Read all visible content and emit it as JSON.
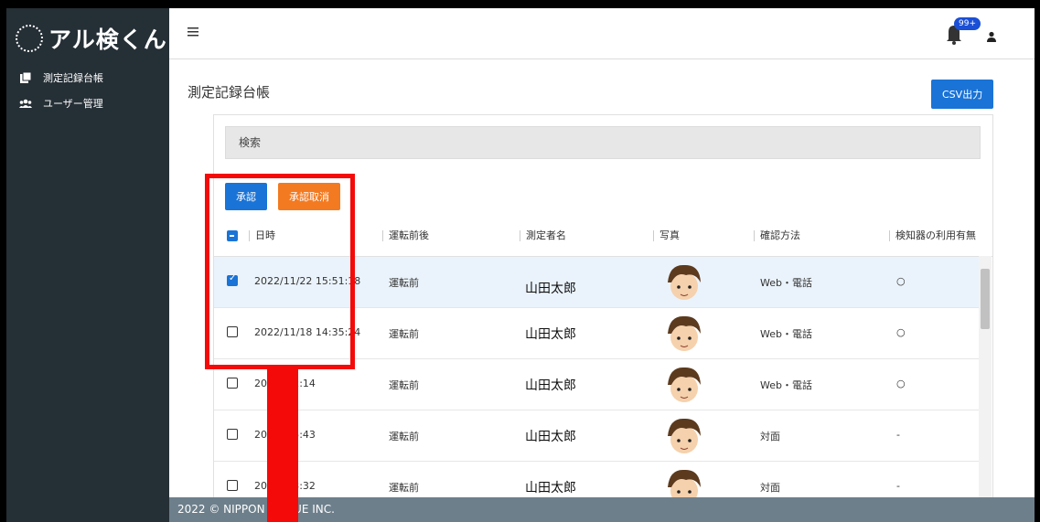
{
  "app": {
    "logo_text": "アル検くん"
  },
  "sidebar": {
    "items": [
      {
        "label": "測定記録台帳",
        "icon": "ledger-icon"
      },
      {
        "label": "ユーザー管理",
        "icon": "users-icon"
      }
    ]
  },
  "header": {
    "notification_badge": "99+",
    "icons": [
      "menu-icon",
      "bell-icon",
      "user-icon"
    ]
  },
  "page": {
    "title": "測定記録台帳",
    "csv_button": "CSV出力"
  },
  "search": {
    "label": "検索"
  },
  "actions": {
    "approve": "承認",
    "cancel_approve": "承認取消"
  },
  "table": {
    "headers": [
      "日時",
      "運転前後",
      "測定者名",
      "写真",
      "確認方法",
      "検知器の利用有無"
    ],
    "header_checkbox": "indeterminate",
    "rows": [
      {
        "checked": true,
        "datetime": "2022/11/22 15:51:18",
        "timing": "運転前",
        "name": "山田太郎",
        "method": "Web・電話",
        "detector": "○"
      },
      {
        "checked": false,
        "datetime": "2022/11/18 14:35:24",
        "timing": "運転前",
        "name": "山田太郎",
        "method": "Web・電話",
        "detector": "○"
      },
      {
        "checked": false,
        "datetime": "2022 :52:14",
        "timing": "運転前",
        "name": "山田太郎",
        "method": "Web・電話",
        "detector": "○"
      },
      {
        "checked": false,
        "datetime": "2022 :45:43",
        "timing": "運転前",
        "name": "山田太郎",
        "method": "対面",
        "detector": "-"
      },
      {
        "checked": false,
        "datetime": "2022 :13:32",
        "timing": "運転前",
        "name": "山田太郎",
        "method": "対面",
        "detector": "-"
      }
    ]
  },
  "footer": {
    "text": "2022 © NIPPON TI IQUE INC."
  },
  "colors": {
    "sidebar": "#252f36",
    "primary": "#1a73d6",
    "accent": "#f37a21",
    "highlight": "#f50a0a",
    "footer": "#6d7f8b"
  }
}
